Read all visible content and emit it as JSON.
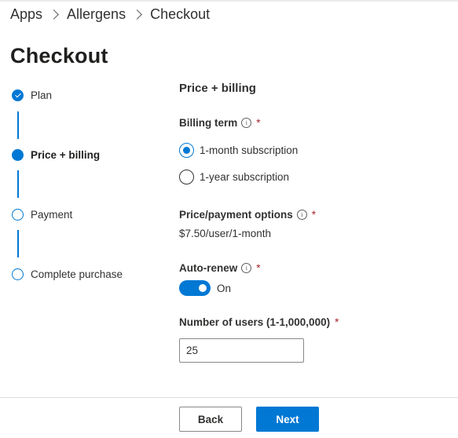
{
  "breadcrumb": {
    "items": [
      "Apps",
      "Allergens",
      "Checkout"
    ]
  },
  "page": {
    "title": "Checkout"
  },
  "steps": [
    {
      "label": "Plan",
      "state": "completed"
    },
    {
      "label": "Price + billing",
      "state": "current"
    },
    {
      "label": "Payment",
      "state": "upcoming"
    },
    {
      "label": "Complete purchase",
      "state": "upcoming"
    }
  ],
  "form": {
    "section_title": "Price + billing",
    "billing_term": {
      "label": "Billing term",
      "required_mark": "*",
      "options": [
        {
          "label": "1-month subscription",
          "selected": true
        },
        {
          "label": "1-year subscription",
          "selected": false
        }
      ]
    },
    "price_options": {
      "label": "Price/payment options",
      "required_mark": "*",
      "value": "$7.50/user/1-month"
    },
    "auto_renew": {
      "label": "Auto-renew",
      "required_mark": "*",
      "state_label": "On",
      "on": true
    },
    "users": {
      "label": "Number of users (1-1,000,000)",
      "required_mark": "*",
      "value": "25"
    },
    "info_glyph": "i"
  },
  "footer": {
    "back_label": "Back",
    "next_label": "Next"
  },
  "colors": {
    "accent": "#0078d4",
    "required": "#a4262c",
    "text": "#323130"
  },
  "icons": [
    "chevron-right-icon",
    "checkmark-icon",
    "info-icon"
  ]
}
